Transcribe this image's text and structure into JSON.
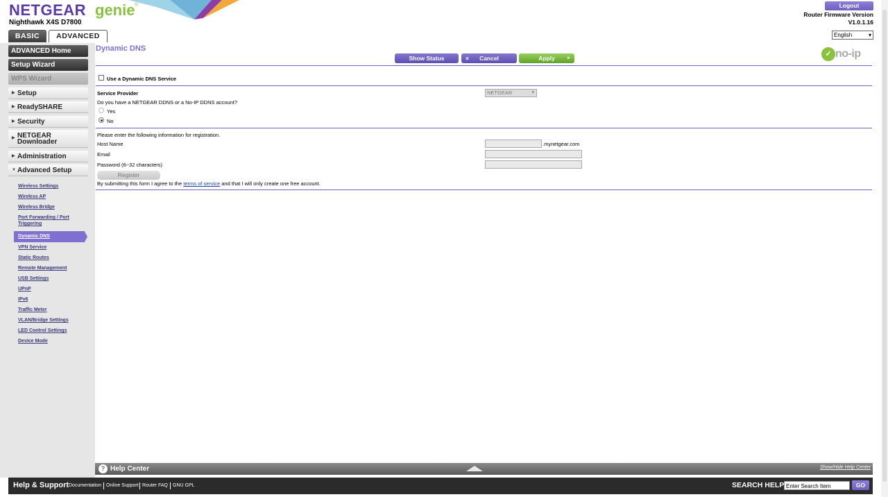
{
  "header": {
    "logo_netgear": "NETGEAR",
    "logo_genie": "genie",
    "logo_reg": "®",
    "model": "Nighthawk X4S D7800",
    "tabs": [
      "BASIC",
      "ADVANCED"
    ],
    "logout": "Logout",
    "firmware_label": "Router Firmware Version",
    "firmware_version": "V1.0.1.16",
    "language": "English"
  },
  "sidebar": {
    "advanced_home": "ADVANCED Home",
    "setup_wizard": "Setup Wizard",
    "wps_wizard": "WPS Wizard",
    "sections": [
      "Setup",
      "ReadySHARE",
      "Security",
      "NETGEAR Downloader",
      "Administration",
      "Advanced Setup"
    ],
    "downloader_line1": "NETGEAR",
    "downloader_line2": "Downloader",
    "sublinks": [
      "Wireless Settings",
      "Wireless AP",
      "Wireless Bridge",
      "Port Forwarding / Port",
      "Triggering",
      "Dynamic DNS",
      "VPN Service",
      "Static Routes",
      "Remote Management",
      "USB Settings",
      "UPnP",
      "IPv6",
      "Traffic Meter",
      "VLAN/Bridge Settings",
      "LED Control Settings",
      "Device Mode"
    ]
  },
  "main": {
    "title": "Dynamic DNS",
    "show_status": "Show Status",
    "cancel": "Cancel",
    "cancel_icon": "×",
    "apply": "Apply",
    "apply_icon": "►",
    "noip_text": "no-ip",
    "use_ddns": "Use a Dynamic DNS Service",
    "use_ddns_checked": false,
    "service_provider_label": "Service Provider",
    "service_provider_value": "NETGEAR",
    "account_question": "Do you have a NETGEAR DDNS or a No-IP DDNS account?",
    "yes": "Yes",
    "no": "No",
    "selected_radio": "No",
    "registration_prompt": "Please enter the following information for registration.",
    "host_name_label": "Host Name",
    "host_suffix": ".mynetgear.com",
    "email_label": "Email",
    "password_label": "Password (6~32 characters)",
    "register": "Register",
    "tos_prefix": "By submitting this form I agree to the",
    "tos_link": "terms of service",
    "tos_suffix": "and that I will only create one free account."
  },
  "help_center": {
    "icon": "?",
    "title": "Help Center",
    "toggle": "Show/Hide Help Center"
  },
  "footer": {
    "title": "Help & Support",
    "links": [
      "Documentation",
      "Online Support",
      "Router FAQ",
      "GNU GPL"
    ],
    "search_label": "SEARCH HELP",
    "search_placeholder": "Enter Search Item",
    "go": "GO"
  },
  "colors": {
    "brand_purple": "#5b3aa6",
    "accent_purple": "#7e6fd0",
    "genie_green": "#8ac13f",
    "apply_green": "#6fb33a"
  }
}
